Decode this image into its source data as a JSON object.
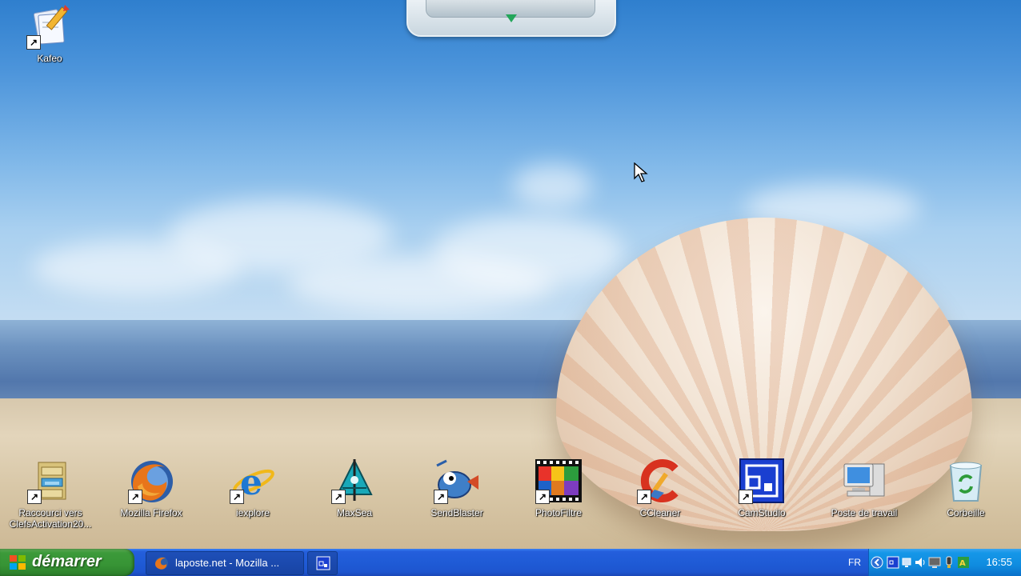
{
  "desktop": {
    "top_icons": [
      {
        "label": "Kafeo",
        "icon": "kafeo-icon"
      }
    ],
    "bottom_icons": [
      {
        "label": "Raccourci vers\nClefsActivation20...",
        "icon": "filing-cabinet-icon"
      },
      {
        "label": "Mozilla Firefox",
        "icon": "firefox-icon"
      },
      {
        "label": "iexplore",
        "icon": "internet-explorer-icon"
      },
      {
        "label": "MaxSea",
        "icon": "maxsea-icon"
      },
      {
        "label": "SendBlaster",
        "icon": "sendblaster-icon"
      },
      {
        "label": "PhotoFiltre",
        "icon": "photofiltre-icon"
      },
      {
        "label": "CCleaner",
        "icon": "ccleaner-icon"
      },
      {
        "label": "CamStudio",
        "icon": "camstudio-icon"
      },
      {
        "label": "Poste de travail",
        "icon": "computer-icon"
      },
      {
        "label": "Corbeille",
        "icon": "recycle-bin-icon"
      }
    ]
  },
  "taskbar": {
    "start_label": "démarrer",
    "tasks": [
      {
        "label": "laposte.net - Mozilla ...",
        "icon": "firefox-icon"
      },
      {
        "label": "",
        "icon": "camstudio-icon"
      }
    ],
    "language": "FR",
    "clock": "16:55"
  },
  "colors": {
    "taskbar_blue": "#245edc",
    "start_green": "#379435",
    "tray_blue": "#0f8ce0"
  }
}
